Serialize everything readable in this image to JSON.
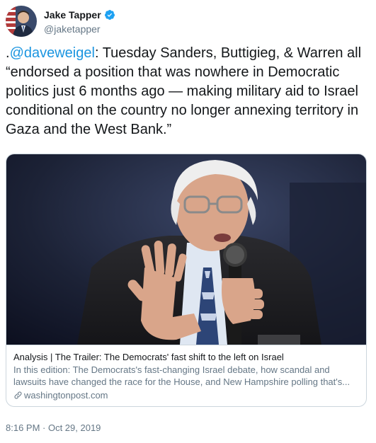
{
  "author": {
    "display_name": "Jake Tapper",
    "handle": "@jaketapper",
    "verified": true,
    "avatar_icon": "profile-photo"
  },
  "tweet": {
    "mention": "@daveweigel",
    "prefix": ".",
    "text": ": Tuesday Sanders, Buttigieg, & Warren all “endorsed a position that was nowhere in Democratic politics just 6 months ago — making military aid to Israel conditional on the country no longer annexing territory in Gaza and the West Bank.”"
  },
  "card": {
    "image_icon": "man-with-microphone-photo",
    "title": "Analysis | The Trailer: The Democrats' fast shift to the left on Israel",
    "description": "In this edition: The Democrats's fast-changing Israel debate, how scandal and lawsuits have changed the race for the House, and New Hampshire polling that's...",
    "domain": "washingtonpost.com"
  },
  "timestamp": "8:16 PM · Oct 29, 2019",
  "colors": {
    "link": "#1b95e0",
    "secondary_text": "#657786",
    "border": "#ccd6dd"
  }
}
